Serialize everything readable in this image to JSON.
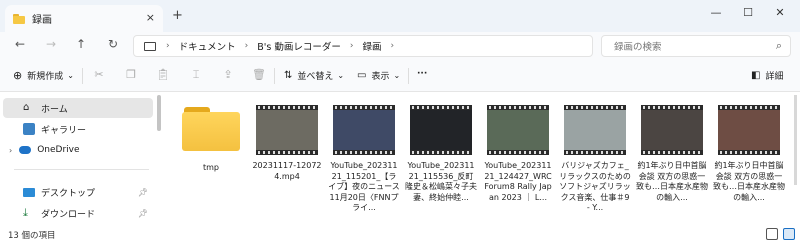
{
  "window": {
    "tab_title": "録画",
    "new_tab": "+",
    "close_tab": "×",
    "minimize": "—",
    "maximize": "☐",
    "close": "✕"
  },
  "nav": {
    "back": "←",
    "forward": "→",
    "up": "↑",
    "refresh": "↻",
    "breadcrumbs": [
      "ドキュメント",
      "B's 動画レコーダー",
      "録画"
    ],
    "search_placeholder": "録画の検索"
  },
  "toolbar": {
    "new_label": "新規作成",
    "sort_label": "並べ替え",
    "view_label": "表示",
    "more_label": "···",
    "details_label": "詳細"
  },
  "sidebar": {
    "items": [
      {
        "label": "ホーム",
        "icon": "home-icon"
      },
      {
        "label": "ギャラリー",
        "icon": "gallery-icon"
      },
      {
        "label": "OneDrive",
        "icon": "cloud-icon"
      },
      {
        "label": "デスクトップ",
        "icon": "desktop-icon"
      },
      {
        "label": "ダウンロード",
        "icon": "download-icon"
      }
    ]
  },
  "files": [
    {
      "name": "tmp",
      "type": "folder"
    },
    {
      "name": "20231117-120724.mp4",
      "type": "video",
      "color": "#6d6b62"
    },
    {
      "name": "YouTube_20231121_115201_【ライブ】夜のニュース 11月20日〈FNNプライ...",
      "type": "video",
      "color": "#3f4a66"
    },
    {
      "name": "YouTube_20231121_115536_反町隆史＆松嶋菜々子夫妻、終始仲睦...",
      "type": "video",
      "color": "#222428"
    },
    {
      "name": "YouTube_20231121_124427_WRC Forum8 Rally Japan 2023 ｜ L...",
      "type": "video",
      "color": "#5a6a58"
    },
    {
      "name": "バリジャズカフェ_リラックスのためのソフトジャズリラックス音楽、仕事＃9 - Y...",
      "type": "video",
      "color": "#9aa3a3"
    },
    {
      "name": "約1年ぶり日中首脳会談 双方の思惑一致も…日本産水産物の輸入...",
      "type": "video",
      "color": "#4b4542"
    },
    {
      "name": "約1年ぶり日中首脳会談 双方の思惑一致も…日本産水産物の輸入...",
      "type": "video",
      "color": "#6e4d44"
    }
  ],
  "status": {
    "count_text": "13 個の項目"
  }
}
